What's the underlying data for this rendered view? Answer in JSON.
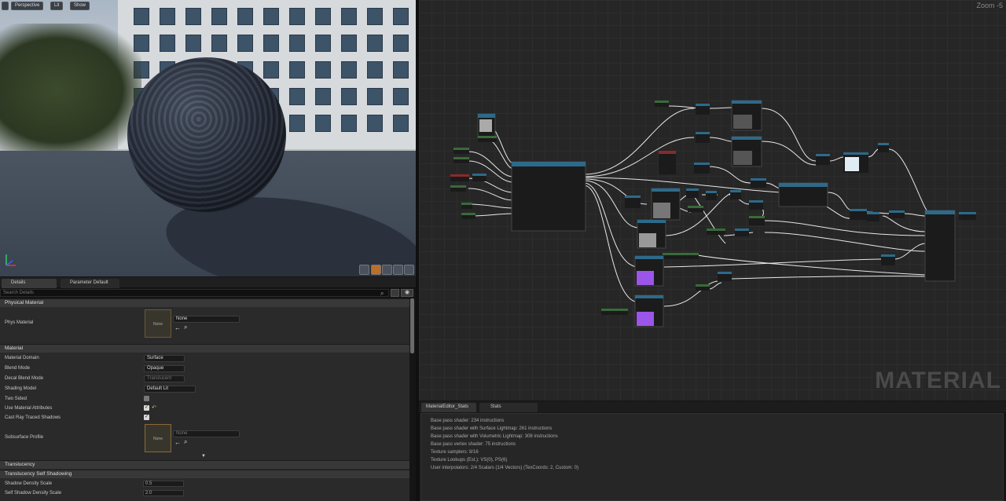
{
  "viewport": {
    "buttons": [
      "Perspective",
      "Lit",
      "Show"
    ]
  },
  "details": {
    "tabs": [
      "Details",
      "Parameter Default"
    ],
    "search_placeholder": "Search Details",
    "sections": {
      "physical": "Physical Material",
      "material": "Material",
      "translucency": "Translucency",
      "translucency_shadow": "Translucency Self Shadowing"
    },
    "phys_material_label": "Phys Material",
    "phys_material_value": "None",
    "thumb_none": "None",
    "rows": [
      {
        "label": "Material Domain",
        "value": "Surface"
      },
      {
        "label": "Blend Mode",
        "value": "Opaque"
      },
      {
        "label": "Decal Blend Mode",
        "value": "Translucent"
      },
      {
        "label": "Shading Model",
        "value": "Default Lit"
      }
    ],
    "checks": [
      {
        "label": "Two Sided",
        "checked": false
      },
      {
        "label": "Use Material Attributes",
        "checked": true
      },
      {
        "label": "Cast Ray Traced Shadows",
        "checked": true
      }
    ],
    "subsurface_label": "Subsurface Profile",
    "subsurface_value": "None",
    "shadow_rows": [
      {
        "label": "Shadow Density Scale",
        "value": "0.5"
      },
      {
        "label": "Self Shadow Density Scale",
        "value": "2.0"
      }
    ]
  },
  "graph": {
    "zoom": "Zoom -5",
    "watermark": "MATERIAL"
  },
  "stats": {
    "tabs": [
      "MaterialEditor_Stats",
      "Stats"
    ],
    "lines": [
      "Base pass shader: 234 instructions",
      "Base pass shader with Surface Lightmap: 261 instructions",
      "Base pass shader with Volumetric Lightmap: 308 instructions",
      "Base pass vertex shader: 75 instructions",
      "Texture samplers: 8/16",
      "Texture Lookups (Est.): VS(0), PS(6)",
      "User interpolators: 2/4 Scalars (1/4 Vectors) (TexCoords: 2, Custom: 0)"
    ]
  }
}
